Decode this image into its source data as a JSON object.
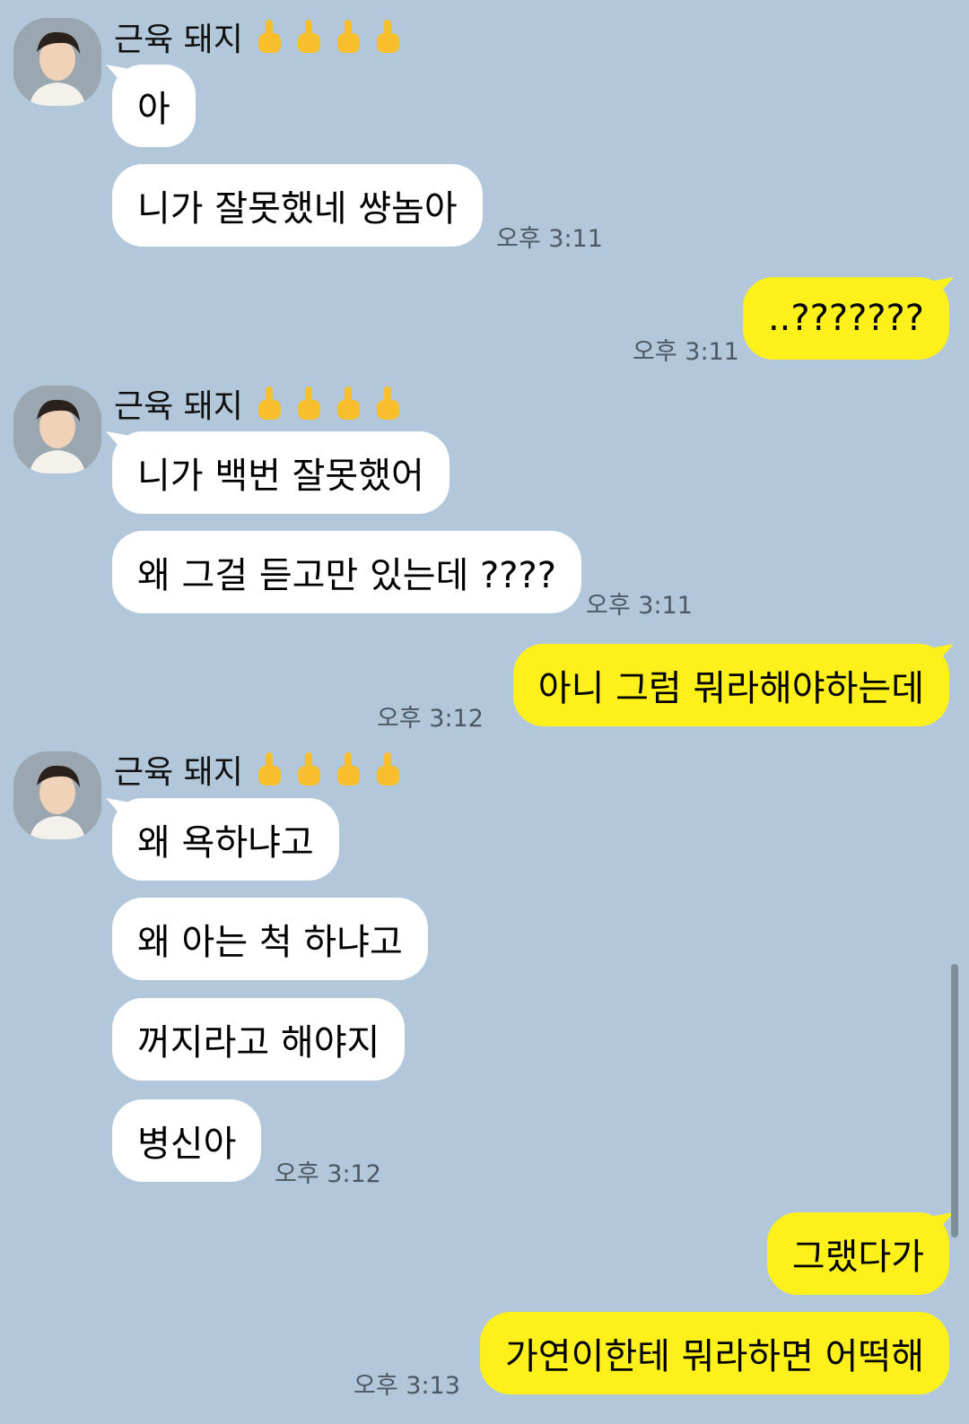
{
  "chat": {
    "sender_name": "근육 돼지",
    "sender_emoji_icons": [
      "middle-finger-icon",
      "middle-finger-icon",
      "middle-finger-icon",
      "middle-finger-icon"
    ],
    "colors": {
      "background": "#b2c7da",
      "incoming_bubble": "#ffffff",
      "outgoing_bubble": "#fef01b"
    },
    "groups": [
      {
        "messages": [
          "아",
          "니가 잘못했네 썅놈아"
        ],
        "time": "오후 3:11"
      },
      {
        "outgoing": [
          "..???????"
        ],
        "time": "오후 3:11"
      },
      {
        "messages": [
          "니가 백번 잘못했어",
          "왜 그걸 듣고만 있는데 ????"
        ],
        "time": "오후 3:11"
      },
      {
        "outgoing": [
          "아니 그럼 뭐라해야하는데"
        ],
        "time": "오후 3:12"
      },
      {
        "messages": [
          "왜 욕하냐고",
          "왜 아는 척 하냐고",
          "꺼지라고 해야지",
          "병신아"
        ],
        "time": "오후 3:12"
      },
      {
        "outgoing": [
          "그랬다가",
          "가연이한테 뭐라하면 어떡해"
        ],
        "time": "오후 3:13"
      }
    ]
  }
}
